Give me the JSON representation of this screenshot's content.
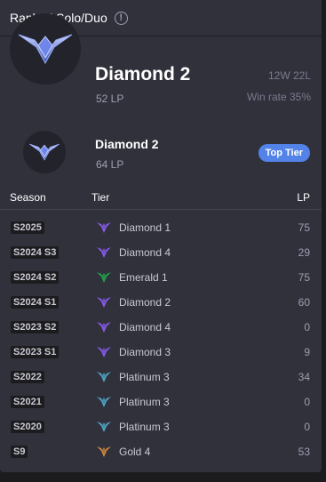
{
  "header": {
    "title": "Ranked Solo/Duo",
    "info_icon": "info-icon"
  },
  "main": {
    "tier": "Diamond 2",
    "lp": "52 LP",
    "record": "12W 22L",
    "win_rate": "Win rate 35%"
  },
  "secondary": {
    "tier": "Diamond 2",
    "lp": "64 LP",
    "badge": "Top Tier"
  },
  "table": {
    "headers": {
      "season": "Season",
      "tier": "Tier",
      "lp": "LP"
    },
    "rows": [
      {
        "season": "S2025",
        "tier": "Diamond 1",
        "lp": "75",
        "color": "#8a5cf0"
      },
      {
        "season": "S2024 S3",
        "tier": "Diamond 4",
        "lp": "29",
        "color": "#8a5cf0"
      },
      {
        "season": "S2024 S2",
        "tier": "Emerald 1",
        "lp": "75",
        "color": "#1fa84a"
      },
      {
        "season": "S2024 S1",
        "tier": "Diamond 2",
        "lp": "60",
        "color": "#8a5cf0"
      },
      {
        "season": "S2023 S2",
        "tier": "Diamond 4",
        "lp": "0",
        "color": "#8a5cf0"
      },
      {
        "season": "S2023 S1",
        "tier": "Diamond 3",
        "lp": "9",
        "color": "#8a5cf0"
      },
      {
        "season": "S2022",
        "tier": "Platinum 3",
        "lp": "34",
        "color": "#4fa8c8"
      },
      {
        "season": "S2021",
        "tier": "Platinum 3",
        "lp": "0",
        "color": "#4fa8c8"
      },
      {
        "season": "S2020",
        "tier": "Platinum 3",
        "lp": "0",
        "color": "#4fa8c8"
      },
      {
        "season": "S9",
        "tier": "Gold 4",
        "lp": "53",
        "color": "#d08a3c"
      }
    ]
  },
  "colors": {
    "panel": "#31313c",
    "background": "#1c1c1f",
    "badge": "#5383e8",
    "muted": "#9e9eb1"
  }
}
